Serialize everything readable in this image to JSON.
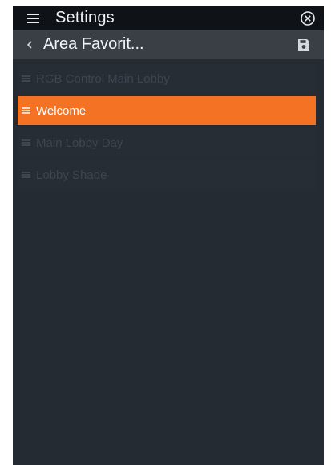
{
  "header": {
    "title": "Settings"
  },
  "subheader": {
    "title": "Area Favorit...",
    "back_icon": "chevron-left-icon",
    "save_icon": "save-icon"
  },
  "favorites": [
    {
      "label": "RGB Control Main Lobby",
      "selected": false
    },
    {
      "label": "Welcome",
      "selected": true
    },
    {
      "label": "Main Lobby Day",
      "selected": false
    },
    {
      "label": "Lobby Shade",
      "selected": false
    }
  ],
  "colors": {
    "accent": "#f47224",
    "background": "#252b33",
    "topbar": "#0f1216",
    "subbar": "#3a3f46"
  }
}
